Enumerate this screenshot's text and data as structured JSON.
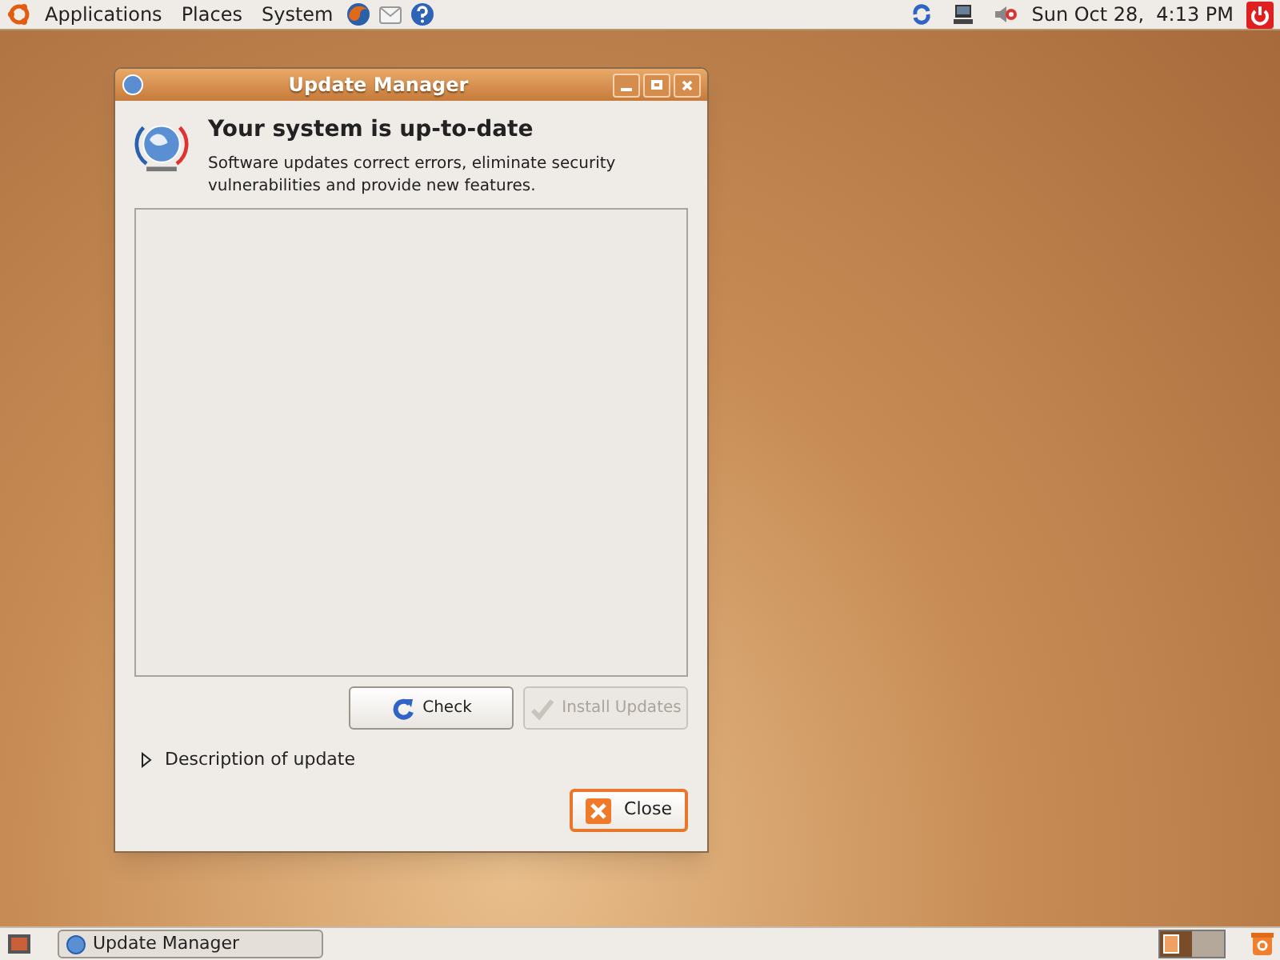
{
  "top_panel": {
    "menus": [
      "Applications",
      "Places",
      "System"
    ],
    "clock": "Sun Oct 28,  4:13 PM"
  },
  "window": {
    "title": "Update Manager",
    "heading": "Your system is up-to-date",
    "description": "Software updates correct errors, eliminate security vulnerabilities and provide new features.",
    "buttons": [
      {
        "label": "Check",
        "kind": "check",
        "disabled": false
      },
      {
        "label": "Install Updates",
        "kind": "install",
        "disabled": true
      }
    ],
    "expander": {
      "label": "Description of update",
      "expanded": false
    },
    "close_button": "Close"
  },
  "bottom_panel": {
    "tasks": [
      {
        "label": "Update Manager"
      }
    ],
    "workspaces": [
      {
        "selected": true
      },
      {
        "selected": false
      }
    ]
  }
}
